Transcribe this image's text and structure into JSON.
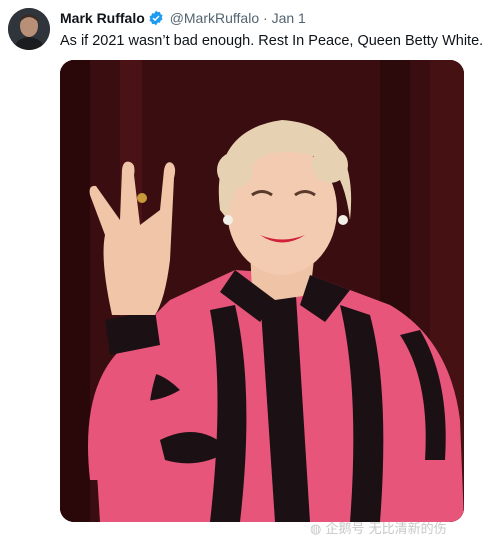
{
  "tweet": {
    "author_name": "Mark Ruffalo",
    "handle": "@MarkRuffalo",
    "separator": "·",
    "date": "Jan 1",
    "text": "As if 2021 wasn’t bad enough. Rest In Peace, Queen Betty White.",
    "verified_icon": "verified-badge-icon"
  },
  "colors": {
    "verified_blue": "#1d9bf0",
    "jacket_pink": "#e8557a",
    "curtain_red": "#3a0e10"
  },
  "watermark": {
    "text": "企鹅号 无比清新的伤",
    "icon": "penguin-icon"
  }
}
